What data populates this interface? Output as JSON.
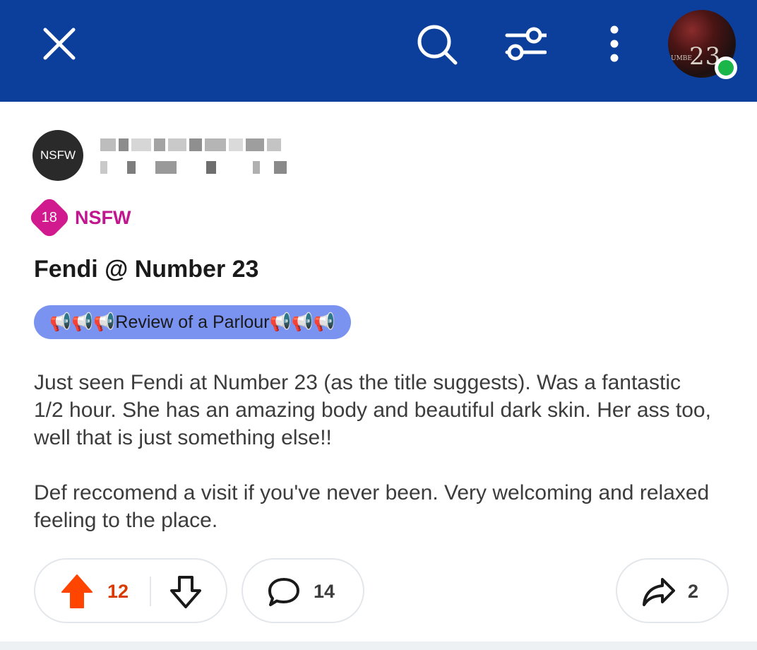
{
  "topbar": {
    "background_color": "#0b3f9b",
    "close_icon": "close-icon",
    "search_icon": "search-icon",
    "filter_icon": "sliders-icon",
    "more_icon": "more-vertical-icon",
    "avatar_text": "23",
    "avatar_small_text": "UMBE",
    "online_status_color": "#1bb64a"
  },
  "post": {
    "subreddit_avatar_text": "NSFW",
    "nsfw_badge_number": "18",
    "nsfw_label": "NSFW",
    "title": "Fendi @ Number 23",
    "flair": "📢📢📢Review of a Parlour📢📢📢",
    "body": [
      "Just seen Fendi at Number 23 (as the title suggests). Was a fantastic 1/2 hour. She has an amazing body and beautiful dark skin. Her ass too, well that is just something else!!",
      "Def reccomend a visit if you've never been. Very welcoming and relaxed feeling to the place."
    ]
  },
  "actions": {
    "score": "12",
    "comments": "14",
    "shares": "2",
    "upvote_color": "#ff4500",
    "score_color": "#d93a00"
  }
}
